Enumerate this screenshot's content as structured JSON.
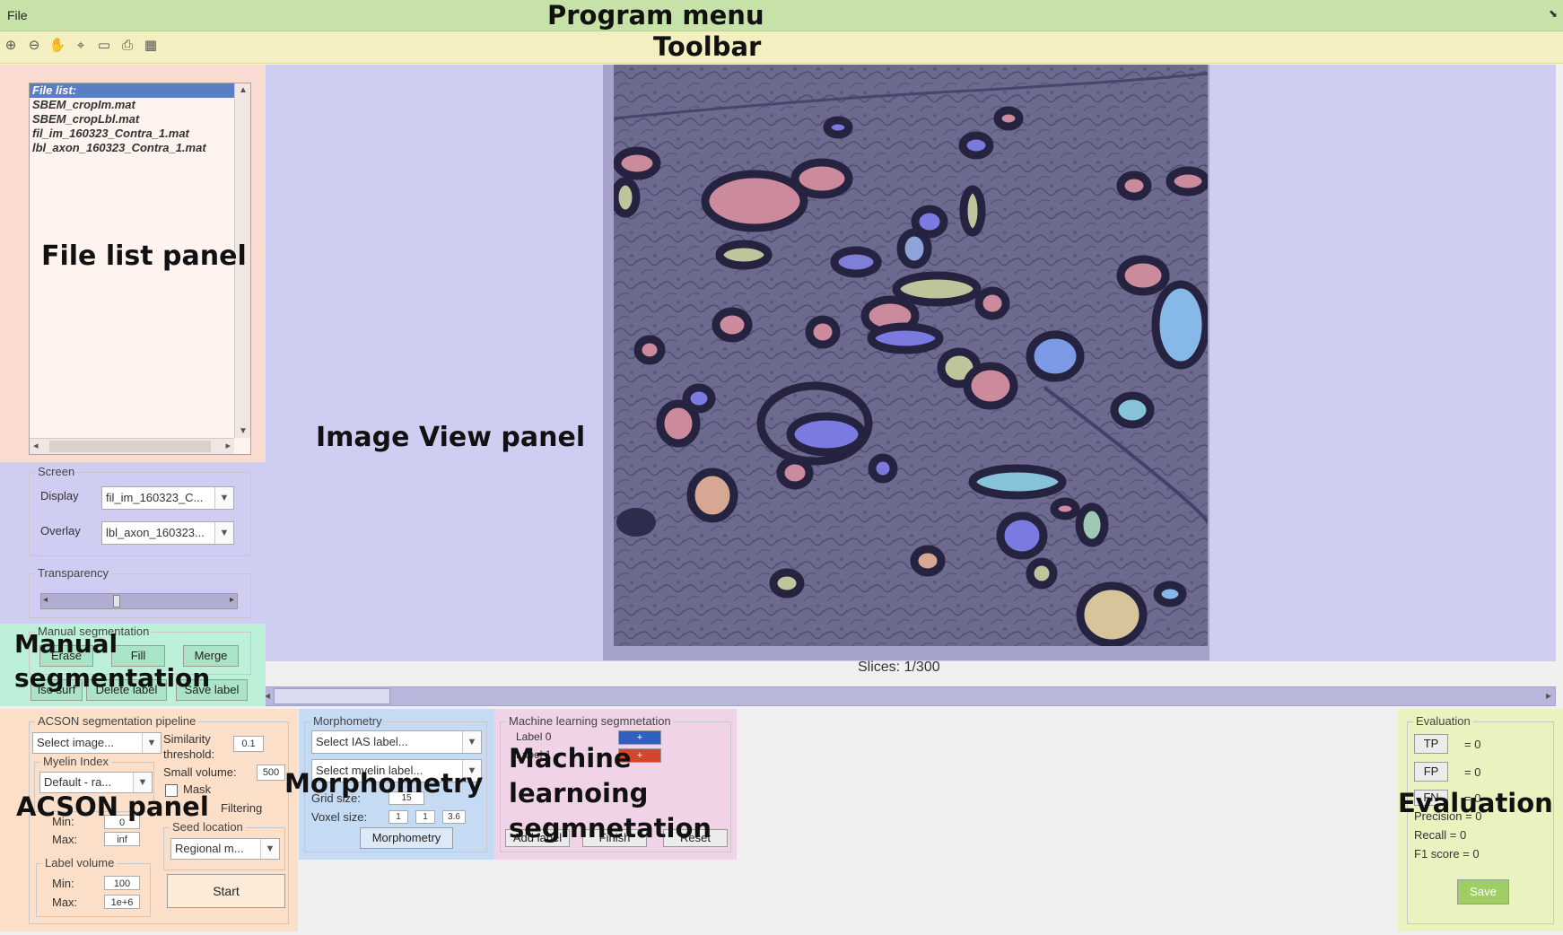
{
  "menu": {
    "file": "File",
    "heading": "Program menu"
  },
  "toolbar": {
    "heading": "Toolbar",
    "tools": [
      {
        "icon": "zoom-in-icon",
        "glyph": "⊕"
      },
      {
        "icon": "zoom-out-icon",
        "glyph": "⊖"
      },
      {
        "icon": "pan-hand-icon",
        "glyph": "✋"
      },
      {
        "icon": "data-cursor-icon",
        "glyph": "⌖"
      },
      {
        "icon": "colorbar-icon",
        "glyph": "▭"
      },
      {
        "icon": "print-icon",
        "glyph": "⎙"
      },
      {
        "icon": "layout-icon",
        "glyph": "▦"
      }
    ]
  },
  "file_panel": {
    "heading": "File list panel",
    "header": "File list:",
    "files": [
      "SBEM_cropIm.mat",
      "SBEM_cropLbl.mat",
      "fil_im_160323_Contra_1.mat",
      "lbl_axon_160323_Contra_1.mat"
    ]
  },
  "screen": {
    "title": "Screen",
    "display_label": "Display",
    "display_value": "fil_im_160323_C...",
    "overlay_label": "Overlay",
    "overlay_value": "lbl_axon_160323..."
  },
  "transparency": {
    "title": "Transparency",
    "level": 0.35
  },
  "manual": {
    "title": "Manual segmentation",
    "heading_line1": "Manual",
    "heading_line2": "segmentation",
    "erase": "Erase",
    "fill": "Fill",
    "merge": "Merge",
    "iso_surf": "Iso surf",
    "delete_label": "Delete label",
    "save_label": "Save label"
  },
  "image_view": {
    "heading": "Image View panel",
    "slices": "Slices: 1/300"
  },
  "acson": {
    "heading": "ACSON panel",
    "title": "ACSON segmentation pipeline",
    "select_image": "Select image...",
    "similarity_label": "Similarity threshold:",
    "similarity_value": "0.1",
    "myelin_title": "Myelin Index",
    "myelin_value": "Default - ra...",
    "small_volume_label": "Small volume:",
    "small_volume_value": "500",
    "mask_label": "Mask",
    "filtering": "Filtering",
    "min_label": "Min:",
    "min_value": "0",
    "max_label": "Max:",
    "max_value": "inf",
    "seed_title": "Seed location",
    "seed_value": "Regional m...",
    "label_volume_title": "Label volume",
    "lv_min_label": "Min:",
    "lv_min_value": "100",
    "lv_max_label": "Max:",
    "lv_max_value": "1e+6",
    "start": "Start"
  },
  "morph": {
    "heading": "Morphometry",
    "title": "Morphometry",
    "select_ias": "Select IAS label...",
    "select_myelin": "Select myelin label...",
    "grid_label": "Grid size:",
    "grid_value": "15",
    "voxel_label": "Voxel size:",
    "voxel": [
      "1",
      "1",
      "3.6"
    ],
    "button": "Morphometry"
  },
  "ml": {
    "heading_l1": "Machine",
    "heading_l2": "learnoing",
    "heading_l3": "segmnetation",
    "title": "Machine learning segmnetation",
    "label0": "Label 0",
    "label1": "Label 1",
    "add_label": "Add label",
    "finish": "Finish",
    "reset": "Reset",
    "colors": {
      "label0": "#2f5fbf",
      "label1": "#d2472b"
    }
  },
  "evaluation": {
    "heading": "Evaluation",
    "title": "Evaluation",
    "tp": "TP",
    "tp_val": "= 0",
    "fp": "FP",
    "fp_val": "= 0",
    "fn": "FN",
    "fn_val": "= 0",
    "precision": "Precision = 0",
    "recall": "Recall = 0",
    "f1": "F1 score = 0",
    "save": "Save"
  }
}
